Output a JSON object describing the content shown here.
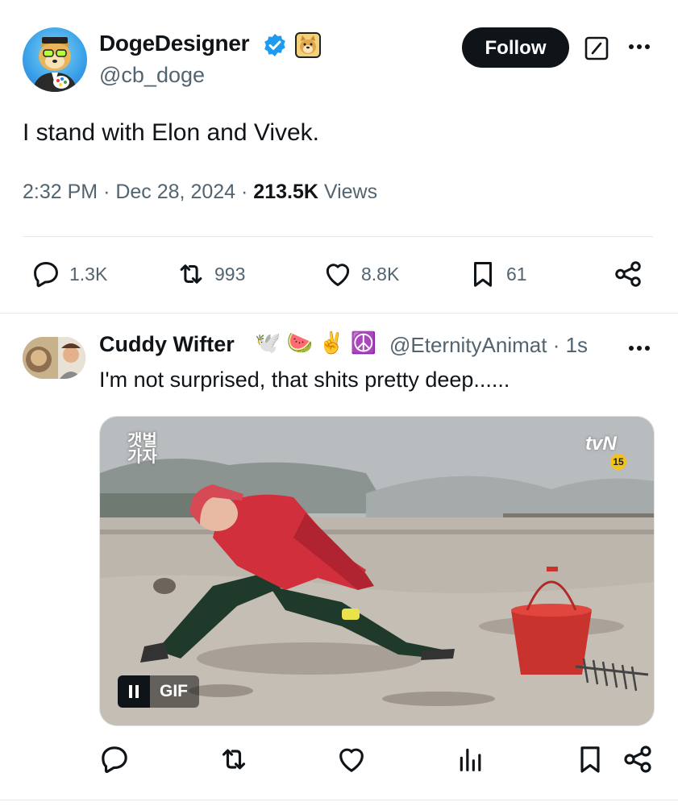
{
  "tweet": {
    "author_name": "DogeDesigner",
    "author_handle": "@cb_doge",
    "follow_label": "Follow",
    "text": "I stand with Elon and Vivek.",
    "time": "2:32 PM",
    "date": "Dec 28, 2024",
    "views_count": "213.5K",
    "views_label": "Views",
    "stats": {
      "replies": "1.3K",
      "reposts": "993",
      "likes": "8.8K",
      "bookmarks": "61"
    },
    "icons": [
      "verified-badge-icon",
      "doge-emoji-icon",
      "grok-icon",
      "more-icon",
      "reply-icon",
      "repost-icon",
      "like-icon",
      "bookmark-icon",
      "share-icon"
    ],
    "accent_color": "#1d9bf0"
  },
  "reply": {
    "author_name": "Cuddy Wifter",
    "author_emojis": "🕊️ 🍉 ✌️ ☮️",
    "author_handle": "@EternityAnimat",
    "age": "· 1s",
    "text": "I'm not surprised, that shits pretty deep......",
    "media": {
      "overlay_title": "갯벌\n가자",
      "channel_logo": "tvN",
      "rating": "15",
      "gif_label": "GIF"
    },
    "icons": [
      "reply-icon",
      "repost-icon",
      "like-icon",
      "views-icon",
      "bookmark-icon",
      "share-icon"
    ]
  }
}
